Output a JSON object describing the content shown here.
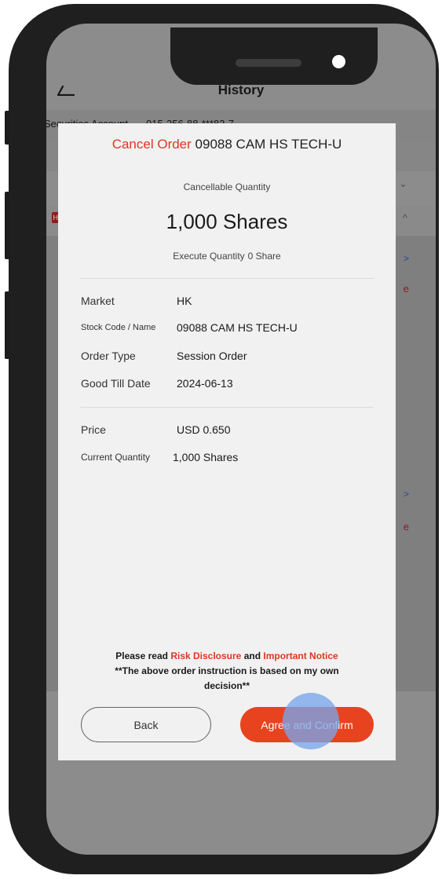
{
  "background": {
    "header": {
      "title": "History",
      "back_icon": "back-arrow-icon"
    },
    "account": {
      "label": "Securities Account",
      "number": "015-256-88-***83-7"
    },
    "market_badge": "HK",
    "row_letter_1": "S",
    "row_letter_2": "S",
    "row_trailing_1": "e",
    "row_trailing_2": "e",
    "chevron_right": ">",
    "chevron_down": "⌄",
    "chevron_up": "^"
  },
  "modal": {
    "title_action": "Cancel Order",
    "title_stock": "09088 CAM HS TECH-U",
    "cancellable_label": "Cancellable Quantity",
    "cancellable_value": "1,000 Shares",
    "execute_label": "Execute Quantity",
    "execute_value": "0 Share",
    "details": [
      {
        "label": "Market",
        "value": "HK"
      },
      {
        "label": "Stock Code / Name",
        "value": "09088 CAM HS TECH-U"
      },
      {
        "label": "Order Type",
        "value": "Session Order"
      },
      {
        "label": "Good Till Date",
        "value": "2024-06-13"
      }
    ],
    "price": [
      {
        "label": "Price",
        "value": "USD 0.650"
      },
      {
        "label": "Current Quantity",
        "value": "1,000 Shares"
      }
    ],
    "notice": {
      "prefix": "Please read",
      "risk_link": "Risk Disclosure",
      "and": "and",
      "notice_link": "Important Notice",
      "line2": "**The above order instruction is based on my own decision**"
    },
    "back_button": "Back",
    "agree_button": "Agree and Confirm"
  },
  "colors": {
    "accent_red": "#d93a20",
    "button_red": "#e8431f",
    "touch_indicator": "#78a5eb"
  }
}
